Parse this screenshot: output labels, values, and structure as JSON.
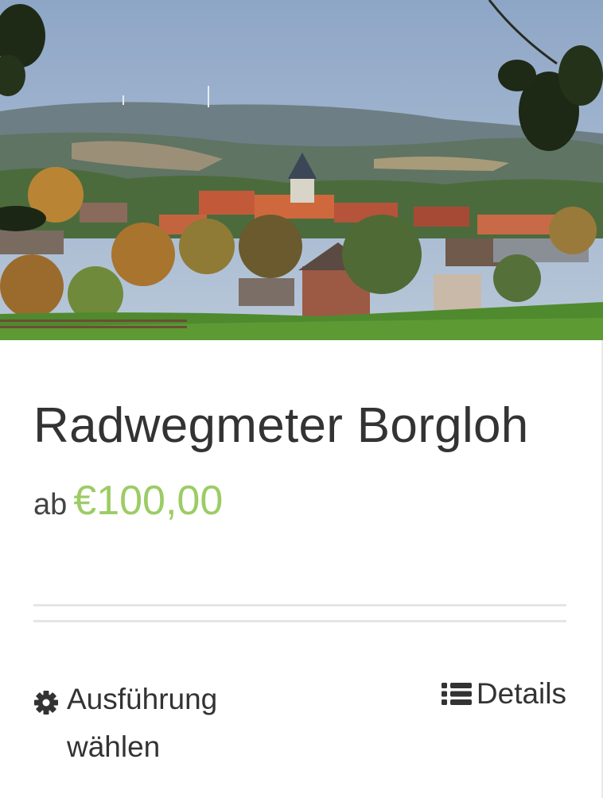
{
  "product": {
    "image_alt": "Radwegmeter Borgloh",
    "title": "Radwegmeter Borgloh",
    "price_prefix": "ab",
    "price_amount": "€100,00"
  },
  "actions": {
    "select_options": {
      "label": "Ausführung wählen",
      "icon": "gear-icon"
    },
    "details": {
      "label": "Details",
      "icon": "list-icon"
    }
  },
  "colors": {
    "price_accent": "#9ccc65",
    "title_text": "#333333",
    "divider": "#e5e5e5"
  }
}
